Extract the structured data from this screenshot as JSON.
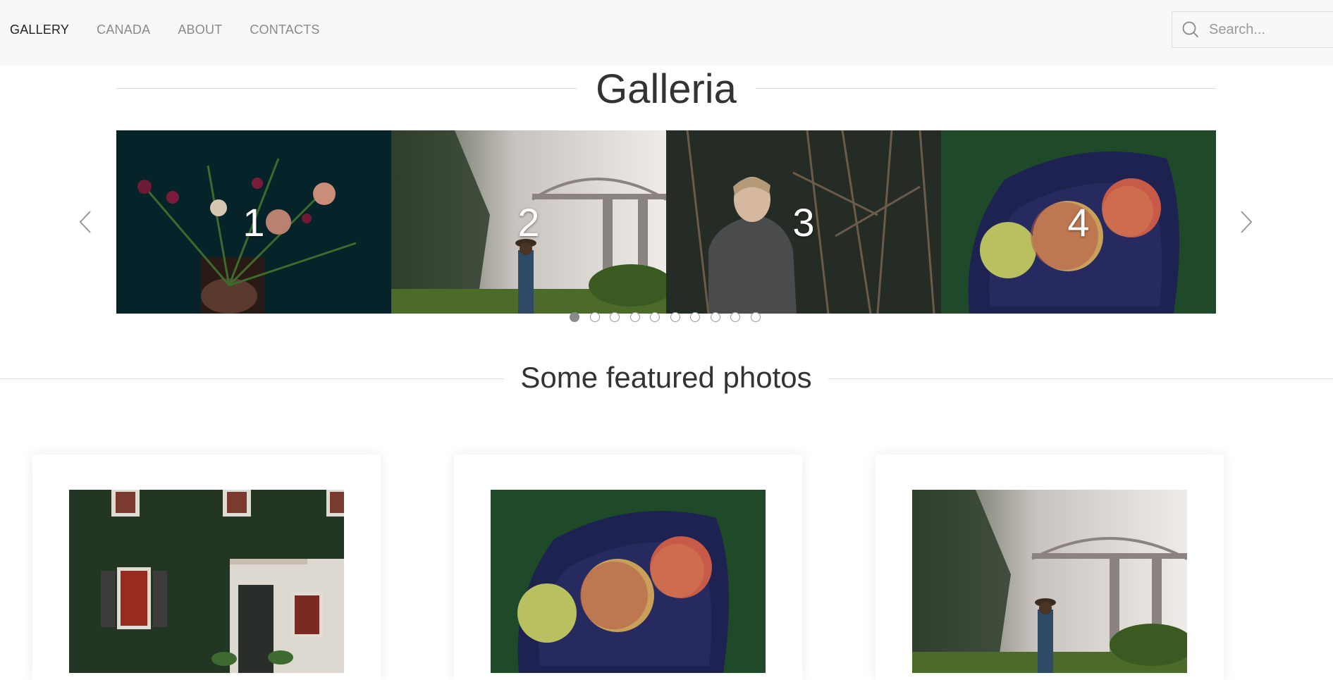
{
  "nav": {
    "items": [
      {
        "label": "GALLERY",
        "active": true
      },
      {
        "label": "CANADA",
        "active": false
      },
      {
        "label": "ABOUT",
        "active": false
      },
      {
        "label": "CONTACTS",
        "active": false
      }
    ],
    "search_placeholder": "Search...",
    "search_icon": "search-icon"
  },
  "galleria": {
    "title": "Galleria",
    "slides": [
      {
        "number": "1",
        "subject": "flowers"
      },
      {
        "number": "2",
        "subject": "bridge-fog"
      },
      {
        "number": "3",
        "subject": "boy-branches"
      },
      {
        "number": "4",
        "subject": "apples"
      }
    ],
    "dots_count": 10,
    "active_dot": 1,
    "prev_icon": "chevron-left-icon",
    "next_icon": "chevron-right-icon"
  },
  "featured": {
    "title": "Some featured photos",
    "cards": [
      {
        "subject": "ivy-house"
      },
      {
        "subject": "apples"
      },
      {
        "subject": "bridge-fog"
      }
    ]
  },
  "colors": {
    "navbar_bg": "#f8f8f8",
    "nav_active": "#222222",
    "nav_inactive": "#8a8a8a",
    "title_text": "#333333",
    "divider": "#dcdcdc"
  }
}
